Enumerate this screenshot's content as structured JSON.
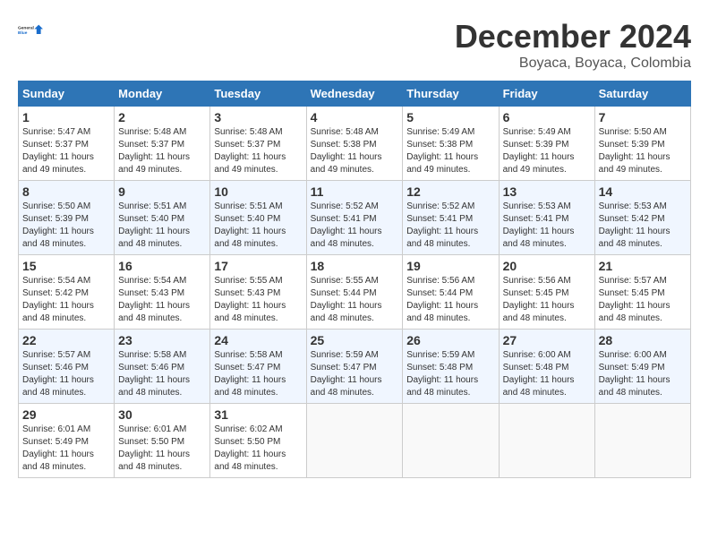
{
  "header": {
    "logo_line1": "General",
    "logo_line2": "Blue",
    "month": "December 2024",
    "location": "Boyaca, Boyaca, Colombia"
  },
  "days_of_week": [
    "Sunday",
    "Monday",
    "Tuesday",
    "Wednesday",
    "Thursday",
    "Friday",
    "Saturday"
  ],
  "weeks": [
    [
      {
        "day": "1",
        "sunrise": "5:47 AM",
        "sunset": "5:37 PM",
        "daylight": "11 hours and 49 minutes."
      },
      {
        "day": "2",
        "sunrise": "5:48 AM",
        "sunset": "5:37 PM",
        "daylight": "11 hours and 49 minutes."
      },
      {
        "day": "3",
        "sunrise": "5:48 AM",
        "sunset": "5:37 PM",
        "daylight": "11 hours and 49 minutes."
      },
      {
        "day": "4",
        "sunrise": "5:48 AM",
        "sunset": "5:38 PM",
        "daylight": "11 hours and 49 minutes."
      },
      {
        "day": "5",
        "sunrise": "5:49 AM",
        "sunset": "5:38 PM",
        "daylight": "11 hours and 49 minutes."
      },
      {
        "day": "6",
        "sunrise": "5:49 AM",
        "sunset": "5:39 PM",
        "daylight": "11 hours and 49 minutes."
      },
      {
        "day": "7",
        "sunrise": "5:50 AM",
        "sunset": "5:39 PM",
        "daylight": "11 hours and 49 minutes."
      }
    ],
    [
      {
        "day": "8",
        "sunrise": "5:50 AM",
        "sunset": "5:39 PM",
        "daylight": "11 hours and 48 minutes."
      },
      {
        "day": "9",
        "sunrise": "5:51 AM",
        "sunset": "5:40 PM",
        "daylight": "11 hours and 48 minutes."
      },
      {
        "day": "10",
        "sunrise": "5:51 AM",
        "sunset": "5:40 PM",
        "daylight": "11 hours and 48 minutes."
      },
      {
        "day": "11",
        "sunrise": "5:52 AM",
        "sunset": "5:41 PM",
        "daylight": "11 hours and 48 minutes."
      },
      {
        "day": "12",
        "sunrise": "5:52 AM",
        "sunset": "5:41 PM",
        "daylight": "11 hours and 48 minutes."
      },
      {
        "day": "13",
        "sunrise": "5:53 AM",
        "sunset": "5:41 PM",
        "daylight": "11 hours and 48 minutes."
      },
      {
        "day": "14",
        "sunrise": "5:53 AM",
        "sunset": "5:42 PM",
        "daylight": "11 hours and 48 minutes."
      }
    ],
    [
      {
        "day": "15",
        "sunrise": "5:54 AM",
        "sunset": "5:42 PM",
        "daylight": "11 hours and 48 minutes."
      },
      {
        "day": "16",
        "sunrise": "5:54 AM",
        "sunset": "5:43 PM",
        "daylight": "11 hours and 48 minutes."
      },
      {
        "day": "17",
        "sunrise": "5:55 AM",
        "sunset": "5:43 PM",
        "daylight": "11 hours and 48 minutes."
      },
      {
        "day": "18",
        "sunrise": "5:55 AM",
        "sunset": "5:44 PM",
        "daylight": "11 hours and 48 minutes."
      },
      {
        "day": "19",
        "sunrise": "5:56 AM",
        "sunset": "5:44 PM",
        "daylight": "11 hours and 48 minutes."
      },
      {
        "day": "20",
        "sunrise": "5:56 AM",
        "sunset": "5:45 PM",
        "daylight": "11 hours and 48 minutes."
      },
      {
        "day": "21",
        "sunrise": "5:57 AM",
        "sunset": "5:45 PM",
        "daylight": "11 hours and 48 minutes."
      }
    ],
    [
      {
        "day": "22",
        "sunrise": "5:57 AM",
        "sunset": "5:46 PM",
        "daylight": "11 hours and 48 minutes."
      },
      {
        "day": "23",
        "sunrise": "5:58 AM",
        "sunset": "5:46 PM",
        "daylight": "11 hours and 48 minutes."
      },
      {
        "day": "24",
        "sunrise": "5:58 AM",
        "sunset": "5:47 PM",
        "daylight": "11 hours and 48 minutes."
      },
      {
        "day": "25",
        "sunrise": "5:59 AM",
        "sunset": "5:47 PM",
        "daylight": "11 hours and 48 minutes."
      },
      {
        "day": "26",
        "sunrise": "5:59 AM",
        "sunset": "5:48 PM",
        "daylight": "11 hours and 48 minutes."
      },
      {
        "day": "27",
        "sunrise": "6:00 AM",
        "sunset": "5:48 PM",
        "daylight": "11 hours and 48 minutes."
      },
      {
        "day": "28",
        "sunrise": "6:00 AM",
        "sunset": "5:49 PM",
        "daylight": "11 hours and 48 minutes."
      }
    ],
    [
      {
        "day": "29",
        "sunrise": "6:01 AM",
        "sunset": "5:49 PM",
        "daylight": "11 hours and 48 minutes."
      },
      {
        "day": "30",
        "sunrise": "6:01 AM",
        "sunset": "5:50 PM",
        "daylight": "11 hours and 48 minutes."
      },
      {
        "day": "31",
        "sunrise": "6:02 AM",
        "sunset": "5:50 PM",
        "daylight": "11 hours and 48 minutes."
      },
      null,
      null,
      null,
      null
    ]
  ]
}
